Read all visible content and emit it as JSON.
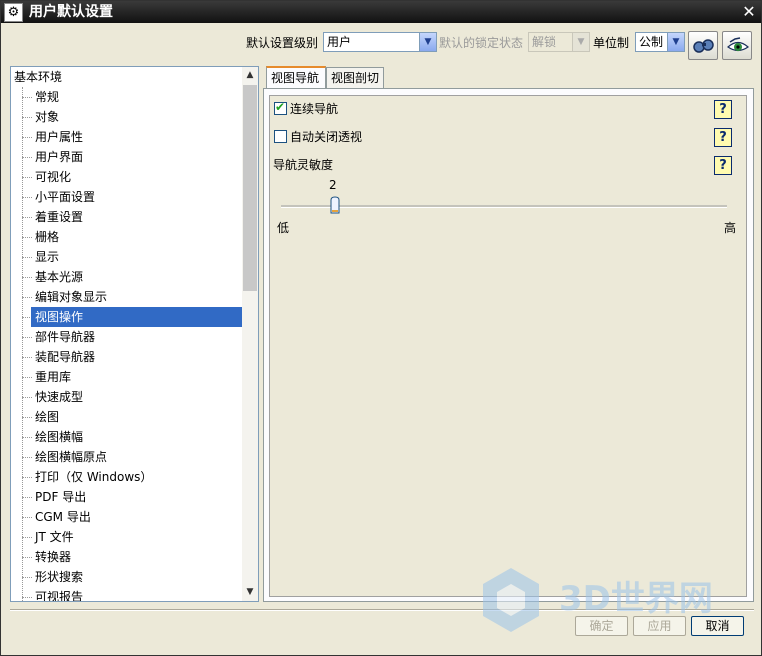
{
  "window": {
    "title": "用户默认设置",
    "title_icon": "gear-icon",
    "close_icon": "close-icon"
  },
  "toolbar": {
    "level_label": "默认设置级别",
    "level_value": "用户",
    "lock_label": "默认的锁定状态",
    "lock_value": "解锁",
    "unit_label": "单位制",
    "unit_value": "公制",
    "btn1_icon": "find-icon",
    "btn2_icon": "view-icon"
  },
  "tree": {
    "root": "基本环境",
    "selected_index": 11,
    "items": [
      "常规",
      "对象",
      "用户属性",
      "用户界面",
      "可视化",
      "小平面设置",
      "着重设置",
      "栅格",
      "显示",
      "基本光源",
      "编辑对象显示",
      "视图操作",
      "部件导航器",
      "装配导航器",
      "重用库",
      "快速成型",
      "绘图",
      "绘图横幅",
      "绘图横幅原点",
      "打印（仅 Windows）",
      "PDF 导出",
      "CGM 导出",
      "JT 文件",
      "转换器",
      "形状搜索",
      "可视报告"
    ]
  },
  "tabs": [
    {
      "label": "视图导航"
    },
    {
      "label": "视图剖切"
    }
  ],
  "panel": {
    "continuous_nav": {
      "label": "连续导航",
      "checked": true
    },
    "auto_close_persp": {
      "label": "自动关闭透视",
      "checked": false
    },
    "sensitivity": {
      "label": "导航灵敏度",
      "value": "2",
      "low": "低",
      "high": "高"
    },
    "help_icon": "?"
  },
  "buttons": {
    "ok": "确定",
    "apply": "应用",
    "cancel": "取消"
  },
  "watermark": {
    "text": "3D世界网"
  }
}
